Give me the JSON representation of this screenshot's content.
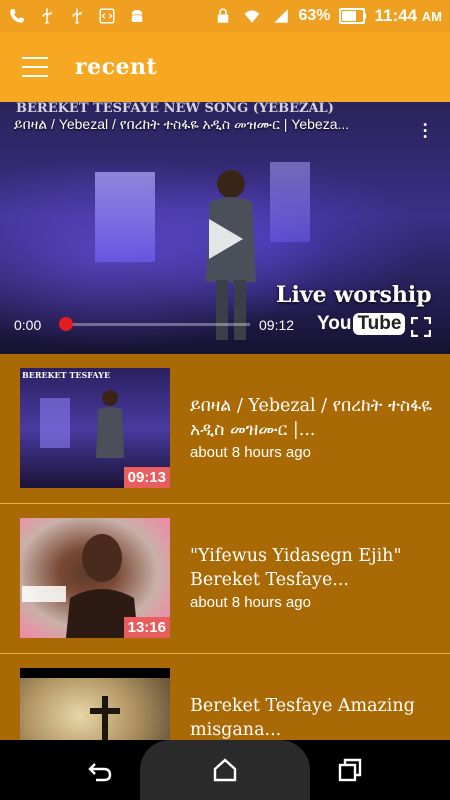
{
  "status_bar": {
    "battery": "63%",
    "time": "11:44",
    "ampm": "AM",
    "icons": [
      "phone-icon",
      "usb-icon",
      "usb-icon",
      "code-icon",
      "android-icon",
      "lock-icon",
      "wifi-icon",
      "signal-icon",
      "battery-icon"
    ]
  },
  "app_bar": {
    "title": "recent",
    "menu_icon": "menu-icon"
  },
  "player": {
    "title": "ይበዛል / Yebezal / የበረከት ተስፋዬ አዲስ መዝሙር | Yebeza...",
    "banner": "BEREKET TESFAYE NEW SONG (YEBEZAL)",
    "overlay_text": "Live worship",
    "current_time": "0:00",
    "duration": "09:12",
    "progress": 0,
    "yt_you": "You",
    "yt_tube": "Tube"
  },
  "videos": [
    {
      "title": "ይበዛል / Yebezal  / የበረከት ተስፋዬ አዲስ መዝሙር |...",
      "meta": "about 8 hours ago",
      "duration": "09:13"
    },
    {
      "title": "\"Yifewus Yidasegn Ejih\" Bereket Tesfaye...",
      "meta": "about 8 hours ago",
      "duration": "13:16"
    },
    {
      "title": "Bereket Tesfaye Amazing misgana...",
      "meta": "",
      "duration": ""
    }
  ],
  "colors": {
    "status_bar": "#F0A020",
    "app_bar": "#F7A823",
    "list_bg": "#A96A06",
    "duration_badge": "#E85E5E"
  }
}
